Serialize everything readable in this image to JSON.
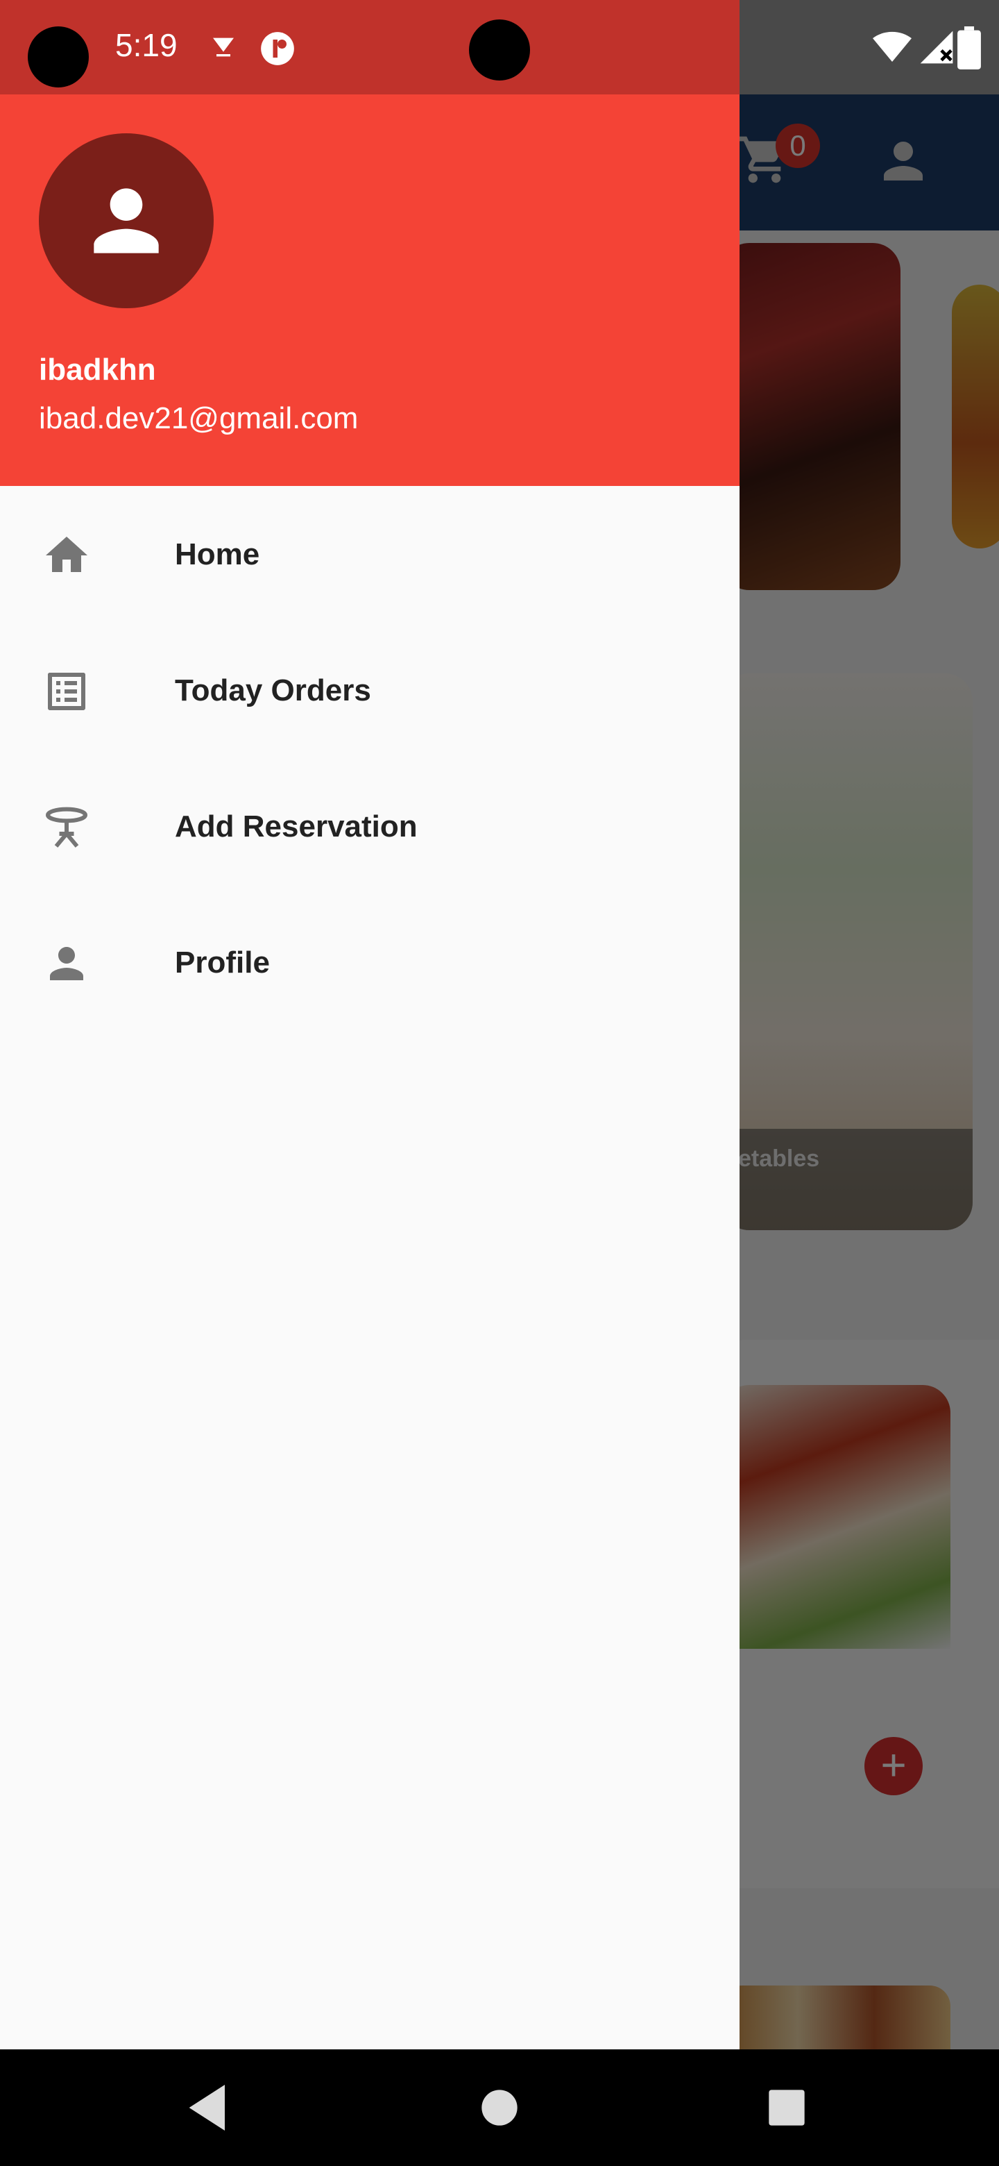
{
  "status_bar": {
    "time": "5:19",
    "icons": [
      "notification-v-icon",
      "app-r-icon",
      "wifi-icon",
      "signal-icon",
      "battery-icon"
    ]
  },
  "background_app": {
    "cart_count": "0",
    "food_caption": "etables",
    "fab_label": "+"
  },
  "drawer": {
    "user": {
      "name": "ibadkhn",
      "email": "ibad.dev21@gmail.com"
    },
    "items": [
      {
        "label": "Home",
        "icon": "home-icon"
      },
      {
        "label": "Today Orders",
        "icon": "list-icon"
      },
      {
        "label": "Add Reservation",
        "icon": "table-icon"
      },
      {
        "label": "Profile",
        "icon": "person-icon"
      }
    ]
  },
  "colors": {
    "header": "#f44336",
    "status_bar": "#c0322b",
    "avatar_bg": "#7b1f19",
    "icon_gray": "#757575"
  },
  "nav_bar": {
    "buttons": [
      "back-icon",
      "home-circle-icon",
      "recents-icon"
    ]
  }
}
